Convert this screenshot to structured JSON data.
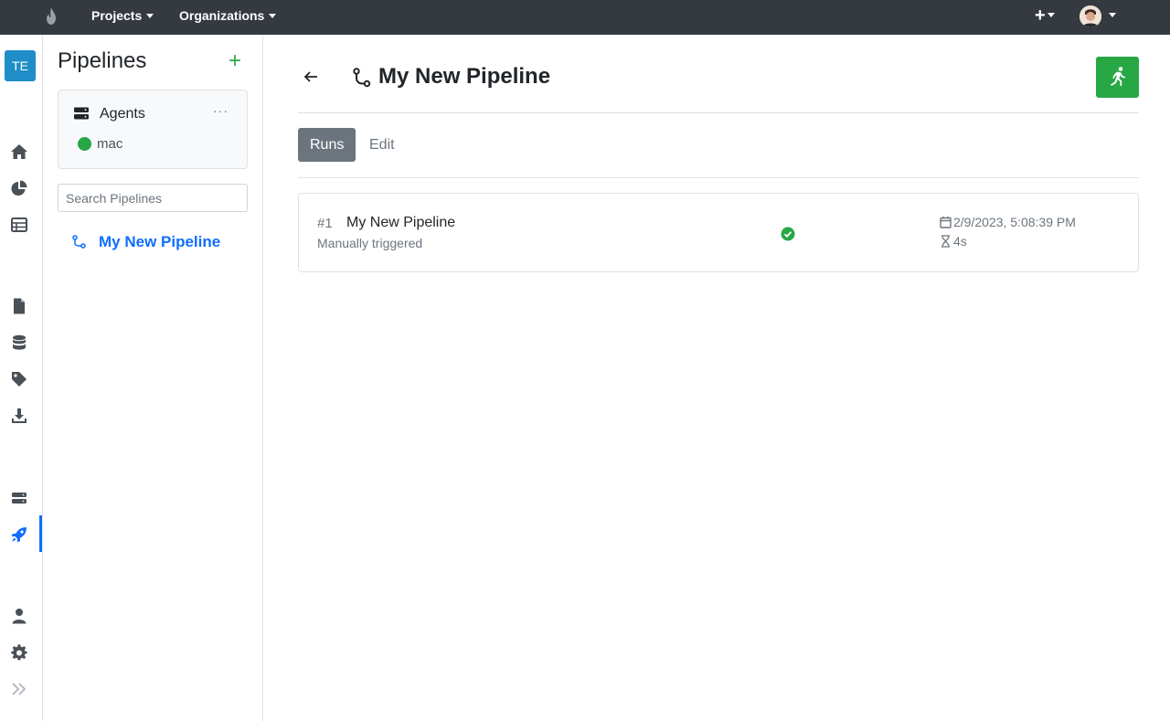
{
  "topbar": {
    "projects_label": "Projects",
    "organizations_label": "Organizations",
    "add_label": "+"
  },
  "rail": {
    "team_badge": "TE"
  },
  "sidebar": {
    "title": "Pipelines",
    "add_label": "+",
    "agents": {
      "title": "Agents",
      "more_label": "···",
      "items": [
        {
          "name": "mac",
          "status_color": "#28a745"
        }
      ]
    },
    "search": {
      "placeholder": "Search Pipelines",
      "value": ""
    },
    "pipelines": [
      {
        "label": "My New Pipeline",
        "active": true
      }
    ]
  },
  "main": {
    "title": "My New Pipeline",
    "tabs": [
      {
        "label": "Runs",
        "active": true
      },
      {
        "label": "Edit",
        "active": false
      }
    ],
    "runs": [
      {
        "number": "#1",
        "name": "My New Pipeline",
        "trigger": "Manually triggered",
        "status": "success",
        "started": "2/9/2023, 5:08:39 PM",
        "duration": "4s"
      }
    ]
  },
  "colors": {
    "topbar": "#343a40",
    "accent": "#0d6efd",
    "success": "#28a745",
    "badge": "#1f8dc7"
  }
}
